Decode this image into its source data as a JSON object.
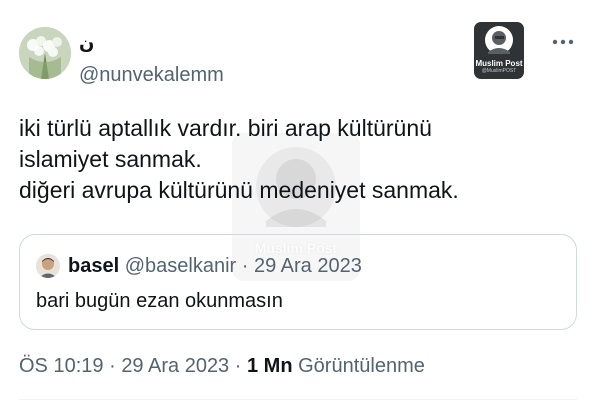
{
  "tweet": {
    "display_name": "ن",
    "username": "@nunvekalemm",
    "text_lines": [
      "iki türlü aptallık vardır. biri arap kültürünü",
      "islamiyet sanmak.",
      "diğeri avrupa kültürünü medeniyet sanmak."
    ],
    "more_icon": "more-horizontal-icon"
  },
  "quote": {
    "name": "basel",
    "username": "@baselkanir",
    "separator": "·",
    "date": "29 Ara 2023",
    "text": "bari bugün ezan okunmasın"
  },
  "meta": {
    "time": "ÖS 10:19",
    "separator1": "·",
    "date": "29 Ara 2023",
    "separator2": "·",
    "views_count": "1 Mn",
    "views_label": "Görüntülenme"
  },
  "watermark": {
    "label": "Muslim Post",
    "handle": "@MuslimPOST"
  },
  "colors": {
    "text": "#0f1419",
    "muted": "#536471",
    "border": "#cfd9de",
    "background": "#ffffff"
  }
}
